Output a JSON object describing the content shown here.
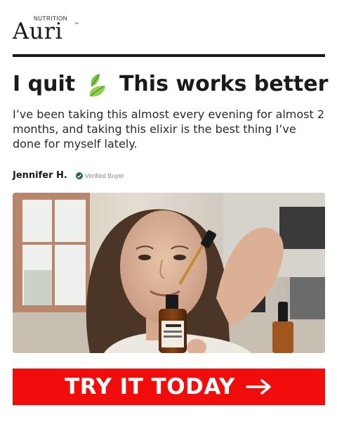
{
  "brand": {
    "small_label": "NUTRITION",
    "name": "Auri",
    "trademark": "™"
  },
  "headline": {
    "part1": "I quit",
    "icon": "leaf-icon",
    "part2": "This works better"
  },
  "review": {
    "text": "I’ve been taking this almost every evening for almost 2 months, and taking this elixir is the best thing I’ve done for myself lately.",
    "author": "Jennifer H.",
    "verified_label": "Verified Buyer"
  },
  "photo": {
    "bottle_brand": "Auri",
    "bottle_label": "Super Mushroom Relief Elixir"
  },
  "cta": {
    "label": "TRY IT TODAY",
    "icon": "arrow-right-icon"
  },
  "colors": {
    "cta_background": "#f20d0d",
    "verified_check": "#1f6b3a",
    "text": "#1a1a1a"
  }
}
